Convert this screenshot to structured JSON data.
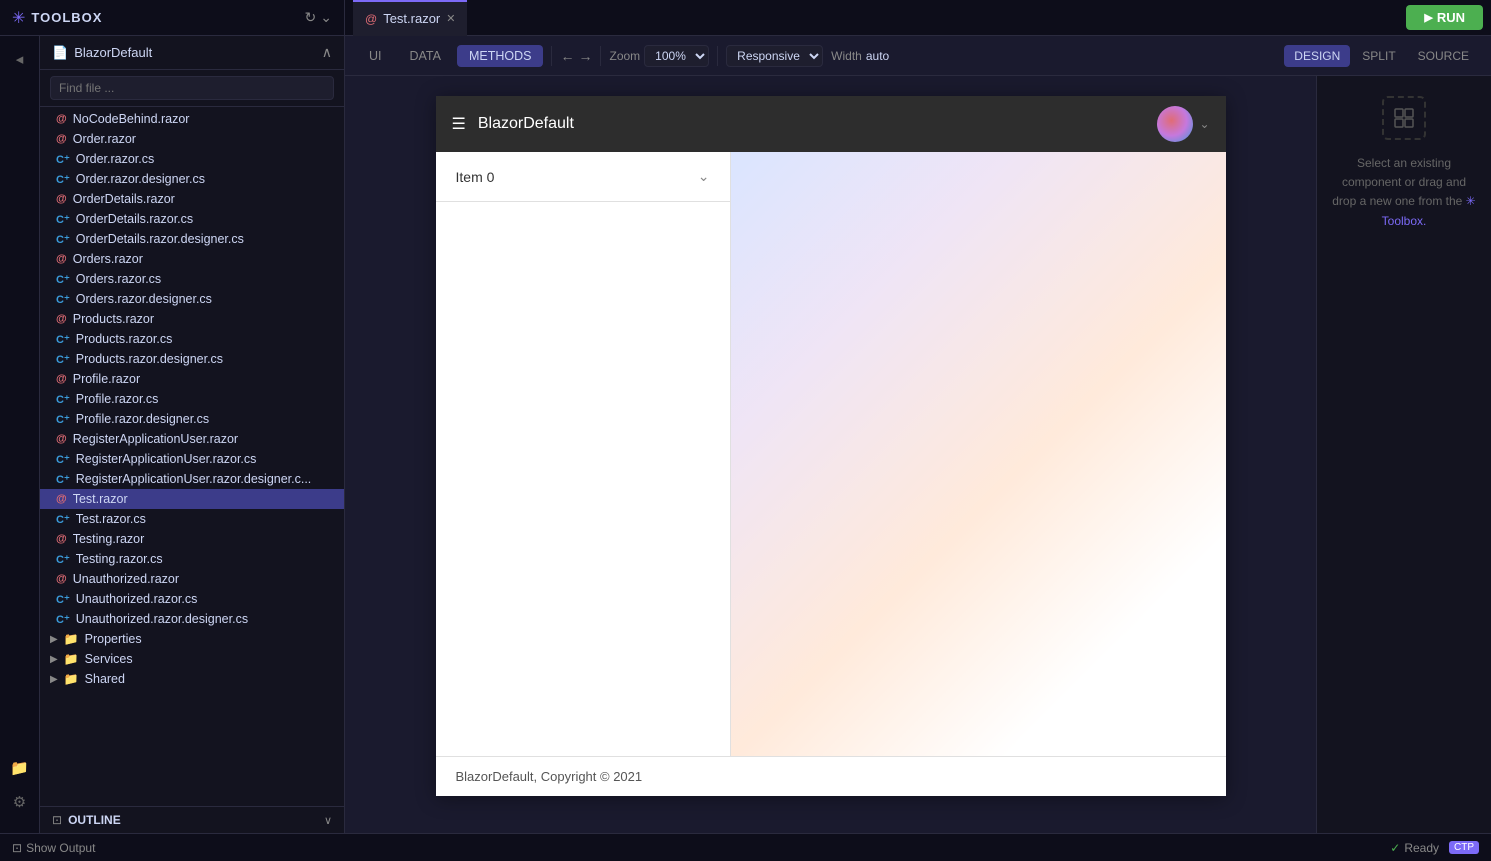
{
  "app": {
    "title": "TOOLBOX",
    "run_label": "RUN"
  },
  "tab": {
    "name": "Test.razor",
    "icon": "@"
  },
  "toolbar": {
    "ui_label": "UI",
    "data_label": "DATA",
    "methods_label": "METHODS",
    "zoom_label": "Zoom",
    "zoom_value": "100%",
    "responsive_label": "Responsive",
    "width_label": "Width",
    "width_value": "auto",
    "design_label": "DESIGN",
    "split_label": "SPLIT",
    "source_label": "SOURCE"
  },
  "sidebar": {
    "title": "BlazorDefault",
    "search_placeholder": "Find file ...",
    "files": [
      {
        "name": "NoCodeBehind.razor",
        "type": "at"
      },
      {
        "name": "Order.razor",
        "type": "at"
      },
      {
        "name": "Order.razor.cs",
        "type": "cs"
      },
      {
        "name": "Order.razor.designer.cs",
        "type": "cs"
      },
      {
        "name": "OrderDetails.razor",
        "type": "at"
      },
      {
        "name": "OrderDetails.razor.cs",
        "type": "cs"
      },
      {
        "name": "OrderDetails.razor.designer.cs",
        "type": "cs"
      },
      {
        "name": "Orders.razor",
        "type": "at"
      },
      {
        "name": "Orders.razor.cs",
        "type": "cs"
      },
      {
        "name": "Orders.razor.designer.cs",
        "type": "cs"
      },
      {
        "name": "Products.razor",
        "type": "at"
      },
      {
        "name": "Products.razor.cs",
        "type": "cs"
      },
      {
        "name": "Products.razor.designer.cs",
        "type": "cs"
      },
      {
        "name": "Profile.razor",
        "type": "at"
      },
      {
        "name": "Profile.razor.cs",
        "type": "cs"
      },
      {
        "name": "Profile.razor.designer.cs",
        "type": "cs"
      },
      {
        "name": "RegisterApplicationUser.razor",
        "type": "at"
      },
      {
        "name": "RegisterApplicationUser.razor.cs",
        "type": "cs"
      },
      {
        "name": "RegisterApplicationUser.razor.designer.cs",
        "type": "cs"
      },
      {
        "name": "Test.razor",
        "type": "at",
        "active": true
      },
      {
        "name": "Test.razor.cs",
        "type": "cs"
      },
      {
        "name": "Testing.razor",
        "type": "at"
      },
      {
        "name": "Testing.razor.cs",
        "type": "cs"
      },
      {
        "name": "Unauthorized.razor",
        "type": "at"
      },
      {
        "name": "Unauthorized.razor.cs",
        "type": "cs"
      },
      {
        "name": "Unauthorized.razor.designer.cs",
        "type": "cs"
      }
    ],
    "folders": [
      {
        "name": "Properties"
      },
      {
        "name": "Services"
      },
      {
        "name": "Shared"
      }
    ]
  },
  "canvas": {
    "brand": "BlazorDefault",
    "item_label": "Item 0",
    "footer_text": "BlazorDefault, Copyright © 2021"
  },
  "right_panel": {
    "hint_text": "Select an existing component or drag and drop a new one from the",
    "toolbox_link": "✳ Toolbox."
  },
  "outline": {
    "label": "OUTLINE"
  },
  "bottom": {
    "show_output": "Show Output",
    "status": "Ready",
    "badge": "CTP"
  }
}
